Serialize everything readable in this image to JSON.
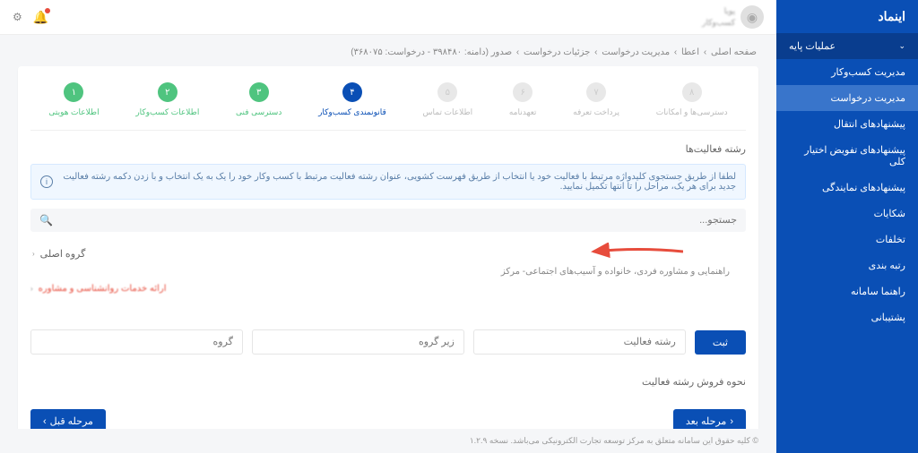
{
  "brand": "اینماد",
  "sidebar": {
    "section": "عملیات پایه",
    "items": [
      {
        "label": "مدیریت کسب‌وکار"
      },
      {
        "label": "مدیریت درخواست"
      },
      {
        "label": "پیشنهادهای انتقال"
      },
      {
        "label": "پیشنهادهای تفویض اختیار کلی"
      },
      {
        "label": "پیشنهادهای نمایندگی"
      },
      {
        "label": "شکایات"
      },
      {
        "label": "تخلفات"
      },
      {
        "label": "رتبه بندی"
      },
      {
        "label": "راهنما سامانه"
      },
      {
        "label": "پشتیبانی"
      }
    ]
  },
  "topbar": {
    "user_name": "پویا",
    "user_role": "کسب‌وکار"
  },
  "breadcrumb": [
    "صفحه اصلی",
    "اعطا",
    "مدیریت درخواست",
    "جزئیات درخواست",
    "صدور (دامنه: ۳۹۸۴۸۰ - درخواست: ۳۶۸۰۷۵)"
  ],
  "steps": [
    {
      "num": "۱",
      "label": "اطلاعات هویتی",
      "state": "done"
    },
    {
      "num": "۲",
      "label": "اطلاعات کسب‌وکار",
      "state": "done"
    },
    {
      "num": "۳",
      "label": "دسترسی فنی",
      "state": "done"
    },
    {
      "num": "۴",
      "label": "قانونمندی کسب‌وکار",
      "state": "active"
    },
    {
      "num": "۵",
      "label": "اطلاعات تماس",
      "state": ""
    },
    {
      "num": "۶",
      "label": "تعهدنامه",
      "state": ""
    },
    {
      "num": "۷",
      "label": "پرداخت تعرفه",
      "state": ""
    },
    {
      "num": "۸",
      "label": "دسترسی‌ها و امکانات",
      "state": ""
    }
  ],
  "section_title": "رشته فعالیت‌ها",
  "info_text": "لطفا از طریق جستجوی کلیدواژه مرتبط با فعالیت خود یا انتخاب از طریق فهرست کشویی، عنوان رشته فعالیت مرتبط با کسب وکار خود را یک به یک انتخاب و با زدن دکمه رشته فعالیت جدید برای هر یک، مراحل را تا انتها تکمیل نمایید.",
  "search_placeholder": "جستجو...",
  "tree": {
    "root": "گروه اصلی",
    "child": "راهنمایی و مشاوره فردی، خانواده و آسیب‌های اجتماعی- مرکز",
    "blurred": "ارائه خدمات روانشناسی و مشاوره"
  },
  "form": {
    "group": "گروه",
    "subgroup": "زیر گروه",
    "activity": "رشته فعالیت",
    "submit": "ثبت"
  },
  "sell_title": "نحوه فروش رشته فعالیت",
  "nav": {
    "prev": "مرحله قبل",
    "next": "مرحله بعد"
  },
  "footer": "© کلیه حقوق این سامانه متعلق به مرکز توسعه تجارت الکترونیکی می‌باشد. نسخه ۱.۲.۹"
}
